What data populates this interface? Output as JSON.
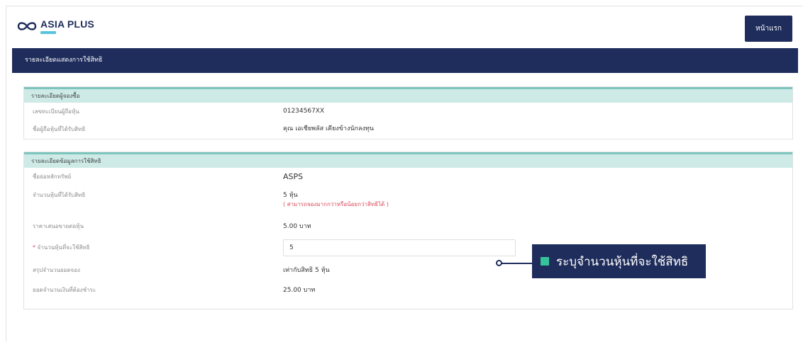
{
  "header": {
    "logo_text": "ASIA PLUS",
    "home_button": "หน้าแรก"
  },
  "title_bar": "รายละเอียดแสดงการใช้สิทธิ",
  "subscriber_card": {
    "title": "รายละเอียดผู้จองซื้อ",
    "rows": [
      {
        "label": "เลขทะเบียนผู้ถือหุ้น",
        "value": "01234567XX"
      },
      {
        "label": "ชื่อผู้ถือหุ้นที่ได้รับสิทธิ",
        "value": "คุณ เอเชียพลัส เคียงข้างนักลงทุน"
      }
    ]
  },
  "rights_card": {
    "title": "รายละเอียดข้อมูลการใช้สิทธิ",
    "security_label": "ชื่อย่อหลักทรัพย์",
    "security_value": "ASPS",
    "shares_received_label": "จำนวนหุ้นที่ได้รับสิทธิ",
    "shares_received_value": "5 หุ้น",
    "shares_received_note": "( สามารถจองมากกว่าหรือน้อยกว่าสิทธิได้ )",
    "offer_price_label": "ราคาเสนอขายต่อหุ้น",
    "offer_price_value": "5.00 บาท",
    "required_mark": "*",
    "exercise_label": "จำนวนหุ้นที่จะใช้สิทธิ",
    "exercise_input_value": "5",
    "summary_label": "สรุปจำนวนยอดจอง",
    "summary_value": "เท่ากับสิทธิ 5 หุ้น",
    "payment_label": "ยอดจำนวนเงินที่ต้องชำระ",
    "payment_value": "25.00 บาท"
  },
  "callout": {
    "text": "ระบุจำนวนหุ้นที่จะใช้สิทธิ"
  },
  "colors": {
    "navy": "#1f2d5c",
    "teal_header": "#cdeae6",
    "teal_border": "#7cc5bd",
    "green_square": "#35c49a",
    "red_note": "#d84a5b"
  }
}
